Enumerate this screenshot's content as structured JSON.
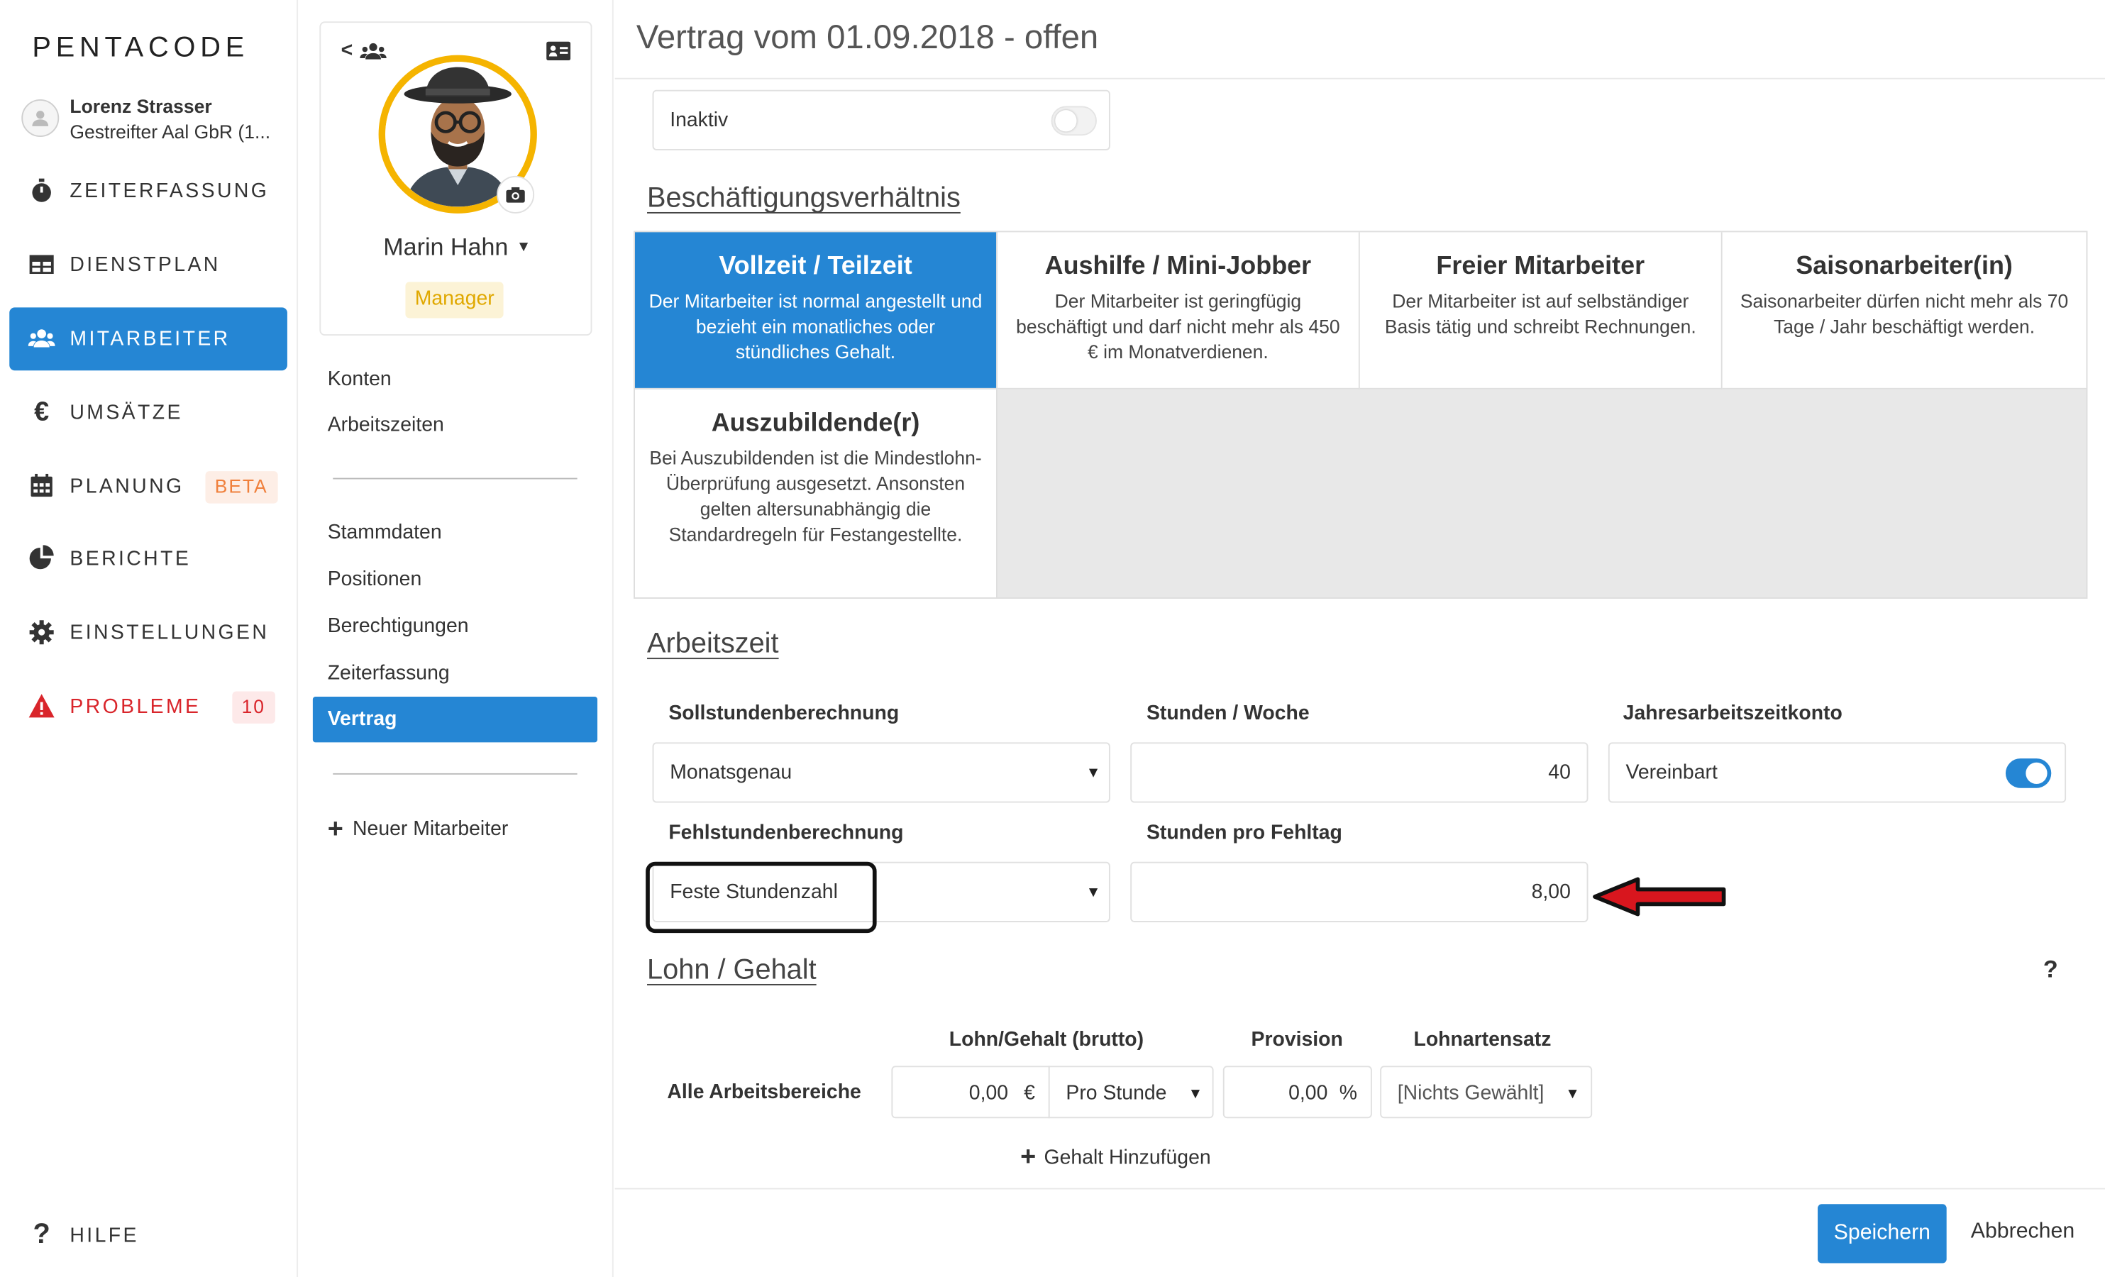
{
  "app": {
    "logo": "PENTACODE"
  },
  "account": {
    "name": "Lorenz Strasser",
    "company": "Gestreifter Aal GbR (1..."
  },
  "nav": [
    {
      "label": "ZEITERFASSUNG",
      "icon": "stopwatch-icon"
    },
    {
      "label": "DIENSTPLAN",
      "icon": "schedule-table-icon"
    },
    {
      "label": "MITARBEITER",
      "icon": "users-icon",
      "active": true
    },
    {
      "label": "UMSÄTZE",
      "icon": "euro-icon"
    },
    {
      "label": "PLANUNG",
      "icon": "calendar-icon",
      "badge": "BETA"
    },
    {
      "label": "BERICHTE",
      "icon": "pie-chart-icon"
    },
    {
      "label": "EINSTELLUNGEN",
      "icon": "gear-icon"
    },
    {
      "label": "PROBLEME",
      "icon": "warning-icon",
      "badge": "10"
    }
  ],
  "help": {
    "label": "HILFE"
  },
  "employee": {
    "back_glyph": "<",
    "name": "Marin Hahn",
    "role": "Manager",
    "links_top": [
      "Konten",
      "Arbeitszeiten"
    ],
    "links": [
      "Stammdaten",
      "Positionen",
      "Berechtigungen",
      "Zeiterfassung",
      "Vertrag"
    ],
    "new_label": "Neuer Mitarbeiter"
  },
  "contract": {
    "title": "Vertrag vom 01.09.2018 - offen",
    "inactive_label": "Inaktiv",
    "inactive_on": false,
    "employment_heading": "Beschäftigungsverhältnis",
    "types": [
      {
        "title": "Vollzeit / Teilzeit",
        "desc": "Der Mitarbeiter ist normal angestellt und bezieht ein monatliches oder stündliches Gehalt.",
        "selected": true
      },
      {
        "title": "Aushilfe / Mini-Jobber",
        "desc": "Der Mitarbeiter ist geringfügig beschäftigt und darf nicht mehr als 450 € im Monatverdienen."
      },
      {
        "title": "Freier Mitarbeiter",
        "desc": "Der Mitarbeiter ist auf selbständiger Basis tätig und schreibt Rechnungen."
      },
      {
        "title": "Saisonarbeiter(in)",
        "desc": "Saisonarbeiter dürfen nicht mehr als 70 Tage / Jahr beschäftigt werden."
      },
      {
        "title": "Auszubildende(r)",
        "desc": "Bei Auszubildenden ist die Mindestlohn-Überprüfung ausgesetzt. Ansonsten gelten altersunabhängig die Standardregeln für Festangestellte."
      }
    ],
    "worktime_heading": "Arbeitszeit",
    "labels": {
      "soll": "Sollstundenberechnung",
      "hours_week": "Stunden / Woche",
      "annual": "Jahresarbeitszeitkonto",
      "absence": "Fehlstundenberechnung",
      "hours_absence": "Stunden pro Fehltag"
    },
    "values": {
      "soll": "Monatsgenau",
      "hours_week": "40",
      "annual": "Vereinbart",
      "annual_on": true,
      "absence": "Feste Stundenzahl",
      "hours_absence": "8,00"
    },
    "wage_heading": "Lohn / Gehalt",
    "help_glyph": "?",
    "wage_headers": {
      "gross": "Lohn/Gehalt (brutto)",
      "commission": "Provision",
      "rate": "Lohnartensatz"
    },
    "wage_row": {
      "area": "Alle Arbeitsbereiche",
      "amount": "0,00",
      "currency": "€",
      "period": "Pro Stunde",
      "commission": "0,00",
      "percent": "%",
      "rate": "[Nichts Gewählt]"
    },
    "add_wage": "Gehalt Hinzufügen"
  },
  "footer": {
    "save": "Speichern",
    "cancel": "Abbrechen"
  },
  "colors": {
    "primary": "#2586d4",
    "danger": "#d9252b",
    "manager_badge_bg": "#fcf3d6",
    "beta_text": "#f0803c"
  }
}
